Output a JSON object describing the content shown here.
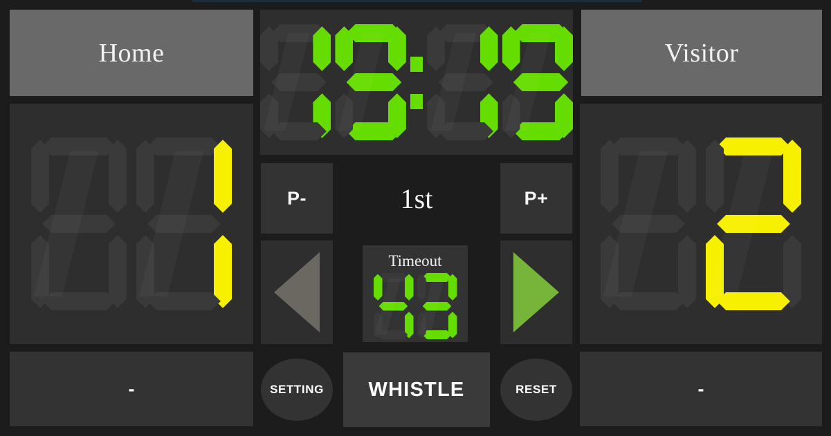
{
  "app": {
    "title": "Scoreboard",
    "background_color": "#1c1c1c",
    "panel_color": "#2e2e2e",
    "header_color": "#696969",
    "accent_green": "#66dd00",
    "accent_yellow": "#f7f000",
    "inactive_segment": "#3a3a3a",
    "possession_active_color": "#76b43a",
    "possession_inactive_color": "#6b6862"
  },
  "home": {
    "name": "Home",
    "score": "1",
    "score_digits": [
      "",
      "1"
    ],
    "score_color": "#f7f000",
    "fouls": "-"
  },
  "visitor": {
    "name": "Visitor",
    "score": "2",
    "score_digits": [
      "",
      "2"
    ],
    "score_color": "#f7f000",
    "fouls": "-"
  },
  "clock": {
    "value": "19:19",
    "minutes_digits": [
      "1",
      "9"
    ],
    "seconds_digits": [
      "1",
      "9"
    ],
    "separator": ":",
    "color": "#66dd00"
  },
  "period": {
    "label": "1st",
    "decrement_label": "P-",
    "increment_label": "P+"
  },
  "possession": {
    "left_icon": "triangle-left-icon",
    "right_icon": "triangle-right-icon",
    "active_side": "right"
  },
  "timeout": {
    "label": "Timeout",
    "value": "43",
    "digits": [
      "4",
      "3"
    ],
    "color": "#66dd00"
  },
  "controls": {
    "setting_label": "SETTING",
    "whistle_label": "WHISTLE",
    "reset_label": "RESET"
  }
}
